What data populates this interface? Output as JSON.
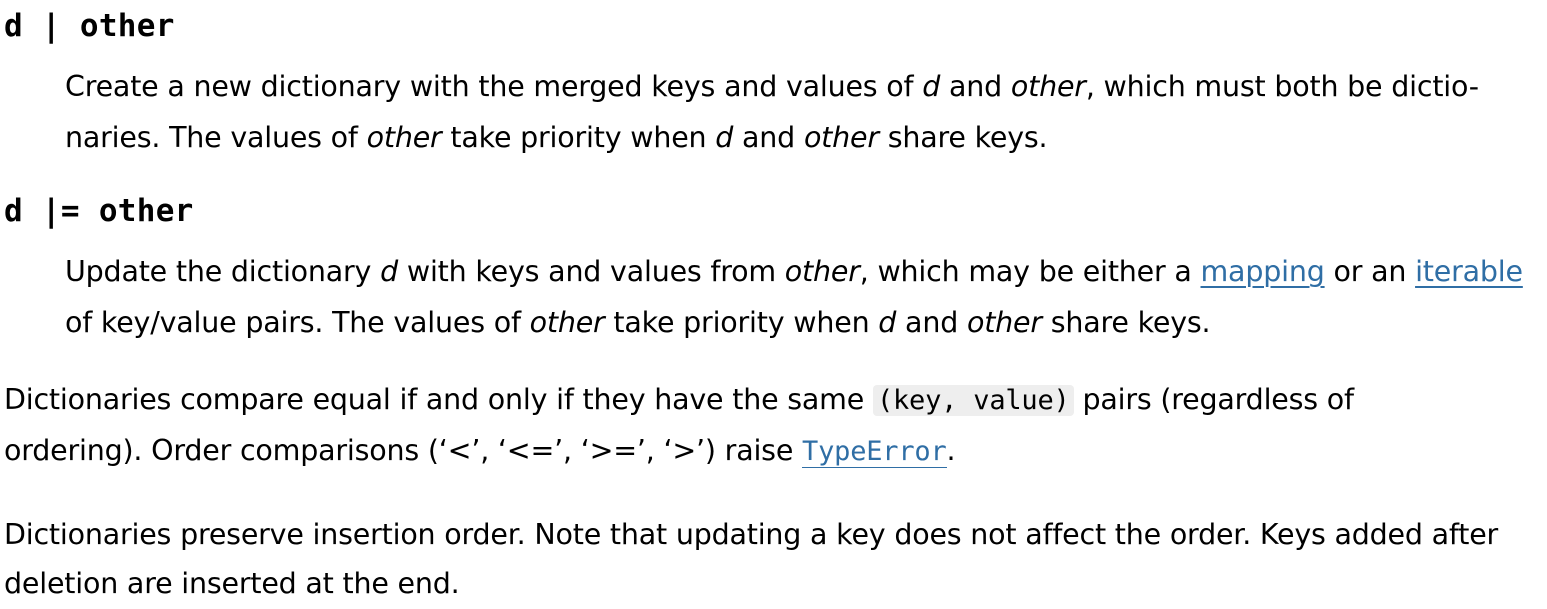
{
  "entries": [
    {
      "signature": "d | other",
      "line1": {
        "t1": "Create a new dictionary with the merged keys and values of ",
        "v1": "d",
        "t2": " and ",
        "v2": "other",
        "t3": ", which must both be dictio-"
      },
      "line2": {
        "t1": "naries. The values of ",
        "v1": "other",
        "t2": " take priority when ",
        "v2": "d",
        "t3": " and ",
        "v3": "other",
        "t4": " share keys."
      }
    },
    {
      "signature": "d |= other",
      "line1": {
        "t1": "Update the dictionary ",
        "v1": "d",
        "t2": " with keys and values from ",
        "v2": "other",
        "t3": ", which may be either a ",
        "link1": "mapping",
        "t4": " or an ",
        "link2": "iterable"
      },
      "line2": {
        "t1": "of key/value pairs. The values of ",
        "v1": "other",
        "t2": " take priority when ",
        "v2": "d",
        "t3": " and ",
        "v3": "other",
        "t4": " share keys."
      }
    }
  ],
  "compare_paragraph": {
    "line1": {
      "t1": "Dictionaries compare equal if and only if they have the same ",
      "code": "(key, value)",
      "t2": " pairs (regardless of"
    },
    "line2": {
      "t1": "ordering). Order comparisons (‘<’, ‘<=’, ‘>=’, ‘>’) raise ",
      "link": "TypeError",
      "t2": "."
    }
  },
  "order_paragraph": {
    "line1": "Dictionaries preserve insertion order. Note that updating a key does not affect the order. Keys added after",
    "line2": "deletion are inserted at the end."
  }
}
